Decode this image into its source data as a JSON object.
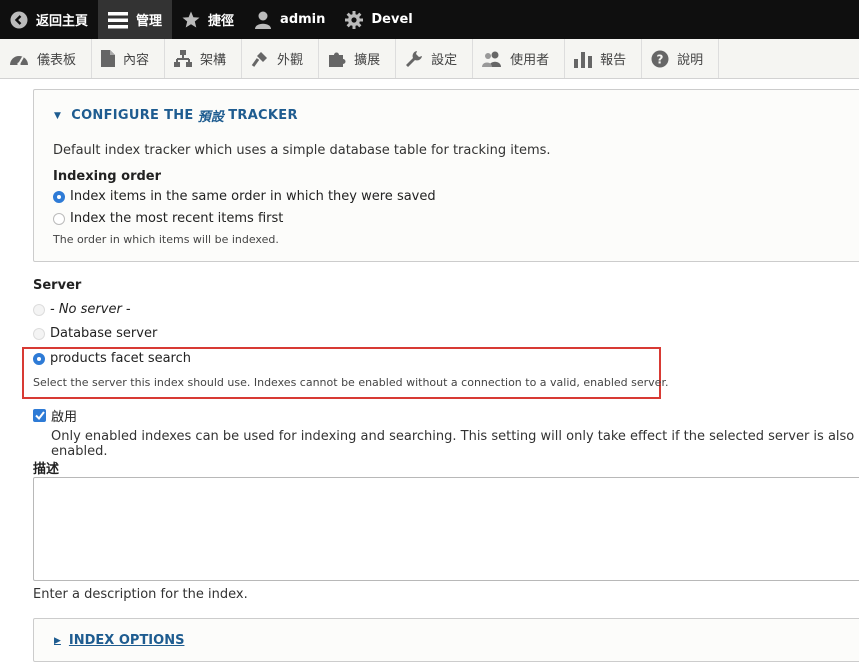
{
  "toolbar": {
    "items": [
      {
        "label": "返回主頁",
        "icon": "back-circle-icon"
      },
      {
        "label": "管理",
        "icon": "hamburger-menu-icon"
      },
      {
        "label": "捷徑",
        "icon": "star-icon"
      },
      {
        "label": "admin",
        "icon": "user-icon"
      },
      {
        "label": "Devel",
        "icon": "gear-icon"
      }
    ]
  },
  "tray": {
    "items": [
      {
        "label": "儀表板",
        "icon": "dashboard-icon"
      },
      {
        "label": "內容",
        "icon": "file-icon"
      },
      {
        "label": "架構",
        "icon": "structure-icon"
      },
      {
        "label": "外觀",
        "icon": "paintbrush-icon"
      },
      {
        "label": "擴展",
        "icon": "puzzle-icon"
      },
      {
        "label": "設定",
        "icon": "wrench-icon"
      },
      {
        "label": "使用者",
        "icon": "people-icon"
      },
      {
        "label": "報告",
        "icon": "bar-chart-icon"
      },
      {
        "label": "說明",
        "icon": "help-icon"
      }
    ]
  },
  "tracker": {
    "summary_prefix": "CONFIGURE THE",
    "summary_em": "預設",
    "summary_suffix": "TRACKER",
    "description": "Default index tracker which uses a simple database table for tracking items.",
    "indexing_order_label": "Indexing order",
    "options": [
      {
        "label": "Index items in the same order in which they were saved",
        "checked": true
      },
      {
        "label": "Index the most recent items first",
        "checked": false
      }
    ],
    "help": "The order in which items will be indexed."
  },
  "server": {
    "label": "Server",
    "options": [
      {
        "label": "- No server -",
        "checked": false,
        "disabled": true
      },
      {
        "label": "Database server",
        "checked": false
      },
      {
        "label": "products facet search",
        "checked": true
      }
    ],
    "help": "Select the server this index should use. Indexes cannot be enabled without a connection to a valid, enabled server."
  },
  "enabled": {
    "label": "啟用",
    "checked": true,
    "help": "Only enabled indexes can be used for indexing and searching. This setting will only take effect if the selected server is also enabled."
  },
  "description_field": {
    "label": "描述",
    "value": "",
    "help": "Enter a description for the index."
  },
  "index_options": {
    "label": "INDEX OPTIONS"
  },
  "colors": {
    "toolbar_bg": "#0f0f0f",
    "link": "#1e5c90",
    "radio_checked": "#2e7bd6",
    "highlight": "#d83a34"
  }
}
